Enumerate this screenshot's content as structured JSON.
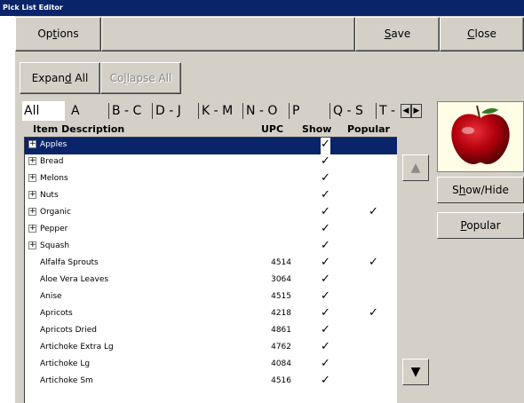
{
  "window": {
    "title": "Pick List Editor"
  },
  "toolbar": {
    "options_pre": "Op",
    "options_u": "t",
    "options_post": "ions",
    "save_u": "S",
    "save_post": "ave",
    "close_u": "C",
    "close_post": "lose"
  },
  "actions": {
    "expand_pre": "Expan",
    "expand_u": "d",
    "expand_post": " All",
    "collapse_pre": "Co",
    "collapse_u": "l",
    "collapse_post": "lapse All"
  },
  "tabs": [
    "All",
    "A",
    "B - C",
    "D - J",
    "K - M",
    "N - O",
    "P",
    "Q - S",
    "T -"
  ],
  "tab_arrows": {
    "left": "◀",
    "right": "▶"
  },
  "columns": {
    "description": "Item Description",
    "upc": "UPC",
    "show": "Show",
    "popular": "Popular"
  },
  "check_glyph": "✓",
  "expand_glyph": "+",
  "items": [
    {
      "description": "Apples",
      "upc": "",
      "show": true,
      "popular": false,
      "expandable": true,
      "selected": true
    },
    {
      "description": "Bread",
      "upc": "",
      "show": true,
      "popular": false,
      "expandable": true
    },
    {
      "description": "Melons",
      "upc": "",
      "show": true,
      "popular": false,
      "expandable": true
    },
    {
      "description": "Nuts",
      "upc": "",
      "show": true,
      "popular": false,
      "expandable": true
    },
    {
      "description": "Organic",
      "upc": "",
      "show": true,
      "popular": true,
      "expandable": true
    },
    {
      "description": "Pepper",
      "upc": "",
      "show": true,
      "popular": false,
      "expandable": true
    },
    {
      "description": "Squash",
      "upc": "",
      "show": true,
      "popular": false,
      "expandable": true
    },
    {
      "description": "Alfalfa Sprouts",
      "upc": "4514",
      "show": true,
      "popular": true
    },
    {
      "description": "Aloe Vera Leaves",
      "upc": "3064",
      "show": true,
      "popular": false
    },
    {
      "description": "Anise",
      "upc": "4515",
      "show": true,
      "popular": false
    },
    {
      "description": "Apricots",
      "upc": "4218",
      "show": true,
      "popular": true
    },
    {
      "description": "Apricots Dried",
      "upc": "4861",
      "show": true,
      "popular": false
    },
    {
      "description": "Artichoke Extra Lg",
      "upc": "4762",
      "show": true,
      "popular": false
    },
    {
      "description": "Artichoke Lg",
      "upc": "4084",
      "show": true,
      "popular": false
    },
    {
      "description": "Artichoke Sm",
      "upc": "4516",
      "show": true,
      "popular": false
    }
  ],
  "scroll": {
    "up": "▲",
    "down": "▼"
  },
  "side": {
    "showhide_pre": "S",
    "showhide_u": "h",
    "showhide_post": "ow/Hide",
    "popular_u": "P",
    "popular_post": "opular"
  },
  "icons": {
    "product_image": "red-apple-icon"
  },
  "colors": {
    "title_bar": "#0a246a",
    "selection": "#0a246a",
    "face": "#d4d0c8",
    "image_bg": "#fffde6",
    "apple": "#b3000c"
  }
}
